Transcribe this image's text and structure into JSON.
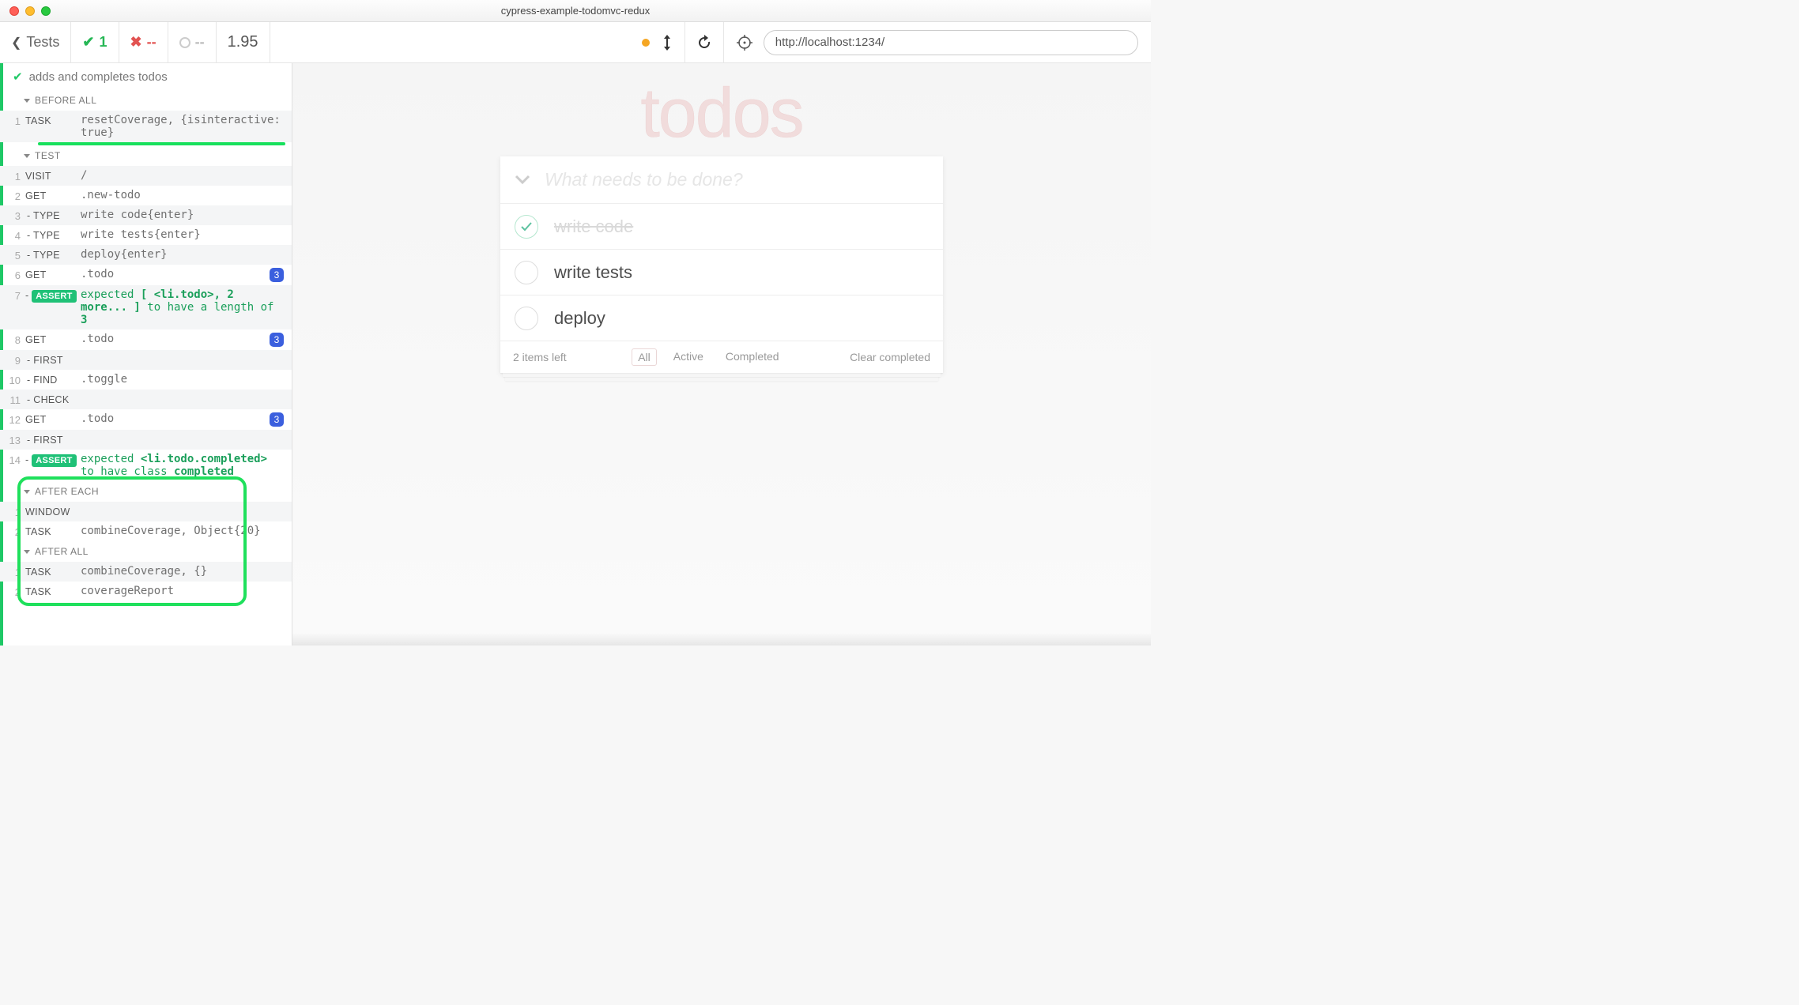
{
  "window": {
    "title": "cypress-example-todomvc-redux"
  },
  "toolbar": {
    "back_label": "Tests",
    "pass_count": "1",
    "fail_count": "--",
    "pending_count": "--",
    "duration": "1.95",
    "url": "http://localhost:1234/"
  },
  "spec": {
    "title": "adds and completes todos"
  },
  "sections": {
    "before_all": {
      "label": "BEFORE ALL",
      "rows": [
        {
          "n": "1",
          "name": "TASK",
          "msg": "resetCoverage, {isinteractive: true}"
        }
      ]
    },
    "test": {
      "label": "TEST",
      "rows": [
        {
          "n": "1",
          "name": "VISIT",
          "msg": "/"
        },
        {
          "n": "2",
          "name": "GET",
          "msg": ".new-todo"
        },
        {
          "n": "3",
          "name": "- TYPE",
          "msg": "write code{enter}"
        },
        {
          "n": "4",
          "name": "- TYPE",
          "msg": "write tests{enter}"
        },
        {
          "n": "5",
          "name": "- TYPE",
          "msg": "deploy{enter}"
        },
        {
          "n": "6",
          "name": "GET",
          "msg": ".todo",
          "badge": "3"
        },
        {
          "n": "7",
          "name": "ASSERT",
          "assert": true,
          "assert_pre": "expected ",
          "assert_b1": "[ <li.todo>, 2 more... ]",
          "assert_mid": " to have a length of ",
          "assert_b2": "3"
        },
        {
          "n": "8",
          "name": "GET",
          "msg": ".todo",
          "badge": "3"
        },
        {
          "n": "9",
          "name": "- FIRST",
          "msg": ""
        },
        {
          "n": "10",
          "name": "- FIND",
          "msg": ".toggle"
        },
        {
          "n": "11",
          "name": "- CHECK",
          "msg": ""
        },
        {
          "n": "12",
          "name": "GET",
          "msg": ".todo",
          "badge": "3"
        },
        {
          "n": "13",
          "name": "- FIRST",
          "msg": ""
        },
        {
          "n": "14",
          "name": "ASSERT",
          "assert": true,
          "assert_pre": "expected ",
          "assert_b1": "<li.todo.completed>",
          "assert_mid": " to have class ",
          "assert_b2": "completed"
        }
      ]
    },
    "after_each": {
      "label": "AFTER EACH",
      "rows": [
        {
          "n": "1",
          "name": "WINDOW",
          "msg": ""
        },
        {
          "n": "2",
          "name": "TASK",
          "msg": "combineCoverage, Object{20}"
        }
      ]
    },
    "after_all": {
      "label": "AFTER ALL",
      "rows": [
        {
          "n": "1",
          "name": "TASK",
          "msg": "combineCoverage, {}"
        },
        {
          "n": "2",
          "name": "TASK",
          "msg": "coverageReport"
        }
      ]
    }
  },
  "todomvc": {
    "logo": "todos",
    "placeholder": "What needs to be done?",
    "items": [
      {
        "text": "write code",
        "completed": true
      },
      {
        "text": "write tests",
        "completed": false
      },
      {
        "text": "deploy",
        "completed": false
      }
    ],
    "footer": {
      "count": "2 items left",
      "filters": {
        "all": "All",
        "active": "Active",
        "completed": "Completed"
      },
      "clear": "Clear completed"
    }
  }
}
